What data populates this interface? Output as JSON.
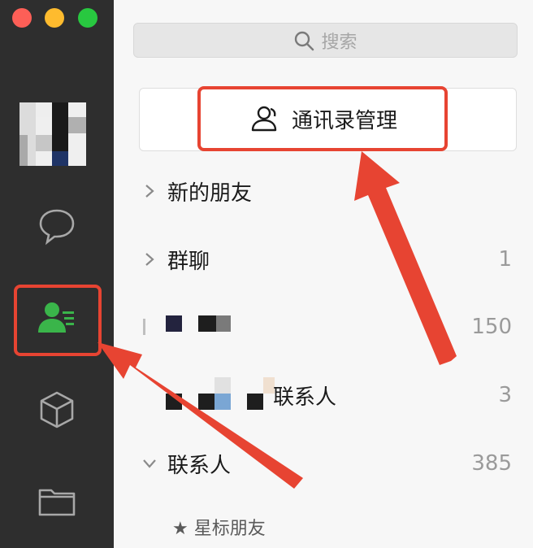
{
  "search": {
    "placeholder": "搜索"
  },
  "manage_button": {
    "label": "通讯录管理"
  },
  "rows": [
    {
      "label": "新的朋友",
      "count": ""
    },
    {
      "label": "群聊",
      "count": "1"
    },
    {
      "label": "",
      "count": "150"
    },
    {
      "label": "联系人",
      "count": "3"
    },
    {
      "label": "联系人",
      "count": "385"
    }
  ],
  "starred": {
    "label": "★ 星标朋友"
  },
  "colors": {
    "accent_red": "#e74432",
    "contacts_green": "#3ab54a",
    "sidebar_bg": "#2e2e2e"
  },
  "icons": [
    "chat-bubble-icon",
    "contacts-icon",
    "cube-icon",
    "folder-icon",
    "search-icon",
    "user-outline-icon",
    "chevron-right-icon",
    "chevron-down-icon"
  ]
}
